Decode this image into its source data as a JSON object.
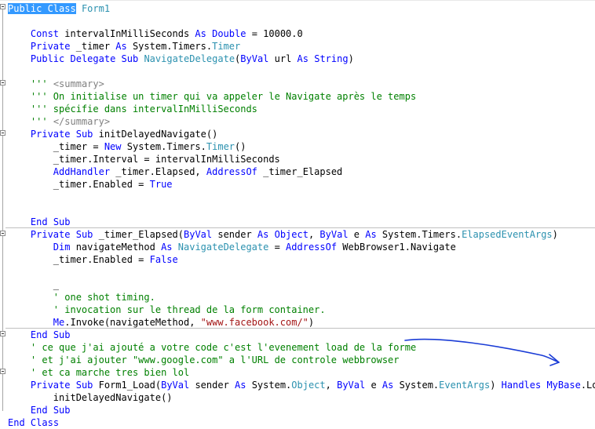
{
  "editor": {
    "lines": [
      [
        {
          "t": "Public Class",
          "c": "hl"
        },
        {
          "t": " "
        },
        {
          "t": "Form1",
          "c": "ty"
        }
      ],
      [],
      [
        {
          "t": "    "
        },
        {
          "t": "Const",
          "c": "kw"
        },
        {
          "t": " intervalInMilliSeconds "
        },
        {
          "t": "As",
          "c": "kw"
        },
        {
          "t": " "
        },
        {
          "t": "Double",
          "c": "kw"
        },
        {
          "t": " = 10000.0"
        }
      ],
      [
        {
          "t": "    "
        },
        {
          "t": "Private",
          "c": "kw"
        },
        {
          "t": " _timer "
        },
        {
          "t": "As",
          "c": "kw"
        },
        {
          "t": " System.Timers."
        },
        {
          "t": "Timer",
          "c": "ty"
        }
      ],
      [
        {
          "t": "    "
        },
        {
          "t": "Public",
          "c": "kw"
        },
        {
          "t": " "
        },
        {
          "t": "Delegate",
          "c": "kw"
        },
        {
          "t": " "
        },
        {
          "t": "Sub",
          "c": "kw"
        },
        {
          "t": " "
        },
        {
          "t": "NavigateDelegate",
          "c": "ty"
        },
        {
          "t": "("
        },
        {
          "t": "ByVal",
          "c": "kw"
        },
        {
          "t": " url "
        },
        {
          "t": "As",
          "c": "kw"
        },
        {
          "t": " "
        },
        {
          "t": "String",
          "c": "kw"
        },
        {
          "t": ")"
        }
      ],
      [],
      [
        {
          "t": "    "
        },
        {
          "t": "'''",
          "c": "cm"
        },
        {
          "t": " "
        },
        {
          "t": "<summary>",
          "c": "xml"
        }
      ],
      [
        {
          "t": "    "
        },
        {
          "t": "''' On initialise un timer qui va appeler le Navigate après le temps",
          "c": "cm"
        }
      ],
      [
        {
          "t": "    "
        },
        {
          "t": "''' spécifie dans intervalInMilliSeconds",
          "c": "cm"
        }
      ],
      [
        {
          "t": "    "
        },
        {
          "t": "'''",
          "c": "cm"
        },
        {
          "t": " "
        },
        {
          "t": "</summary>",
          "c": "xml"
        }
      ],
      [
        {
          "t": "    "
        },
        {
          "t": "Private",
          "c": "kw"
        },
        {
          "t": " "
        },
        {
          "t": "Sub",
          "c": "kw"
        },
        {
          "t": " initDelayedNavigate()"
        }
      ],
      [
        {
          "t": "        _timer = "
        },
        {
          "t": "New",
          "c": "kw"
        },
        {
          "t": " System.Timers."
        },
        {
          "t": "Timer",
          "c": "ty"
        },
        {
          "t": "()"
        }
      ],
      [
        {
          "t": "        _timer.Interval = intervalInMilliSeconds"
        }
      ],
      [
        {
          "t": "        "
        },
        {
          "t": "AddHandler",
          "c": "kw"
        },
        {
          "t": " _timer.Elapsed, "
        },
        {
          "t": "AddressOf",
          "c": "kw"
        },
        {
          "t": " _timer_Elapsed"
        }
      ],
      [
        {
          "t": "        _timer.Enabled = "
        },
        {
          "t": "True",
          "c": "kw"
        }
      ],
      [],
      [],
      [
        {
          "t": "    "
        },
        {
          "t": "End",
          "c": "kw"
        },
        {
          "t": " "
        },
        {
          "t": "Sub",
          "c": "kw"
        }
      ],
      [
        {
          "t": "    "
        },
        {
          "t": "Private",
          "c": "kw"
        },
        {
          "t": " "
        },
        {
          "t": "Sub",
          "c": "kw"
        },
        {
          "t": " _timer_Elapsed("
        },
        {
          "t": "ByVal",
          "c": "kw"
        },
        {
          "t": " sender "
        },
        {
          "t": "As",
          "c": "kw"
        },
        {
          "t": " "
        },
        {
          "t": "Object",
          "c": "kw"
        },
        {
          "t": ", "
        },
        {
          "t": "ByVal",
          "c": "kw"
        },
        {
          "t": " e "
        },
        {
          "t": "As",
          "c": "kw"
        },
        {
          "t": " System.Timers."
        },
        {
          "t": "ElapsedEventArgs",
          "c": "ty"
        },
        {
          "t": ")"
        }
      ],
      [
        {
          "t": "        "
        },
        {
          "t": "Dim",
          "c": "kw"
        },
        {
          "t": " navigateMethod "
        },
        {
          "t": "As",
          "c": "kw"
        },
        {
          "t": " "
        },
        {
          "t": "NavigateDelegate",
          "c": "ty"
        },
        {
          "t": " = "
        },
        {
          "t": "AddressOf",
          "c": "kw"
        },
        {
          "t": " WebBrowser1.Navigate"
        }
      ],
      [
        {
          "t": "        _timer.Enabled = "
        },
        {
          "t": "False",
          "c": "kw"
        }
      ],
      [],
      [
        {
          "t": "        _"
        }
      ],
      [
        {
          "t": "        "
        },
        {
          "t": "' one shot timing.",
          "c": "cm"
        }
      ],
      [
        {
          "t": "        "
        },
        {
          "t": "' invocation sur le thread de la form container.",
          "c": "cm"
        }
      ],
      [
        {
          "t": "        "
        },
        {
          "t": "Me",
          "c": "kw"
        },
        {
          "t": ".Invoke(navigateMethod, "
        },
        {
          "t": "\"www.facebook.com/\"",
          "c": "st"
        },
        {
          "t": ")"
        }
      ],
      [
        {
          "t": "    "
        },
        {
          "t": "End",
          "c": "kw"
        },
        {
          "t": " "
        },
        {
          "t": "Sub",
          "c": "kw"
        }
      ],
      [
        {
          "t": "    "
        },
        {
          "t": "' ce que j'ai ajouté a votre code c'est l'evenement load de la forme",
          "c": "cm"
        }
      ],
      [
        {
          "t": "    "
        },
        {
          "t": "' et j'ai ajouter \"www.google.com\" a l'URL de controle webbrowser",
          "c": "cm"
        }
      ],
      [
        {
          "t": "    "
        },
        {
          "t": "' et ca marche tres bien lol",
          "c": "cm"
        }
      ],
      [
        {
          "t": "    "
        },
        {
          "t": "Private",
          "c": "kw"
        },
        {
          "t": " "
        },
        {
          "t": "Sub",
          "c": "kw"
        },
        {
          "t": " Form1_Load("
        },
        {
          "t": "ByVal",
          "c": "kw"
        },
        {
          "t": " sender "
        },
        {
          "t": "As",
          "c": "kw"
        },
        {
          "t": " System."
        },
        {
          "t": "Object",
          "c": "ty"
        },
        {
          "t": ", "
        },
        {
          "t": "ByVal",
          "c": "kw"
        },
        {
          "t": " e "
        },
        {
          "t": "As",
          "c": "kw"
        },
        {
          "t": " System."
        },
        {
          "t": "EventArgs",
          "c": "ty"
        },
        {
          "t": ") "
        },
        {
          "t": "Handles",
          "c": "kw"
        },
        {
          "t": " "
        },
        {
          "t": "MyBase",
          "c": "kw"
        },
        {
          "t": ".Load"
        }
      ],
      [
        {
          "t": "        initDelayedNavigate()"
        }
      ],
      [
        {
          "t": "    "
        },
        {
          "t": "End",
          "c": "kw"
        },
        {
          "t": " "
        },
        {
          "t": "Sub",
          "c": "kw"
        }
      ],
      [
        {
          "t": "End",
          "c": "kw"
        },
        {
          "t": " "
        },
        {
          "t": "Class",
          "c": "kw"
        }
      ]
    ],
    "colors": {
      "keyword": "#0000ff",
      "type": "#2b91af",
      "comment": "#008000",
      "xml_doc_tag": "#808080",
      "string": "#a31515",
      "selection": "#3399ff",
      "annotation_ink": "#1a3cd6"
    }
  }
}
